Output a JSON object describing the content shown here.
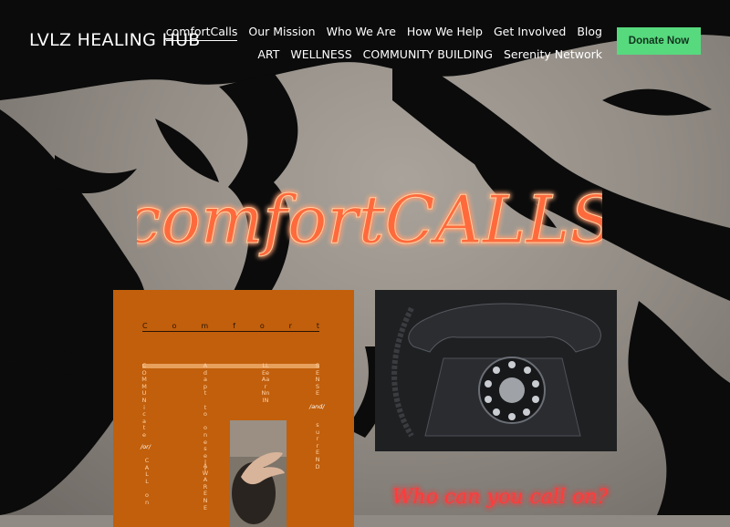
{
  "site": {
    "title": "LVLZ HEALING HUB"
  },
  "nav": {
    "row1": [
      "comfortCalls",
      "Our Mission",
      "Who We Are",
      "How We Help",
      "Get Involved",
      "Blog"
    ],
    "row2": [
      "ART",
      "WELLNESS",
      "COMMUNITY BUILDING",
      "Serenity Network"
    ],
    "active": "comfortCalls"
  },
  "donate_label": "Donate Now",
  "hero": {
    "title": "comfortCALLS"
  },
  "card": {
    "word_letters": [
      "C",
      "o",
      "m",
      "f",
      "o",
      "r",
      "t"
    ],
    "col1": [
      "C",
      "O",
      "M",
      "M",
      "U",
      "N",
      "i",
      "c",
      "a",
      "t",
      "e"
    ],
    "col2": [
      "A",
      "d",
      "a",
      "p",
      "t",
      "",
      "t",
      "o",
      "",
      "o",
      "n",
      "e",
      "s",
      "e",
      "l",
      "f"
    ],
    "col3": [
      "LL",
      "Ee",
      "Aa",
      "r",
      "Nn",
      "IN"
    ],
    "col4": [
      "S",
      "E",
      "N",
      "S",
      "E"
    ],
    "col1b": [
      "C",
      "A",
      "L",
      "L",
      "",
      "o",
      "n"
    ],
    "col2b": [
      "A",
      "W",
      "A",
      "R",
      "E",
      "N",
      "E"
    ],
    "col4b": [
      "s",
      "u",
      "r",
      "r",
      "E",
      "N",
      "D"
    ],
    "tag_or": "/or/",
    "tag_and": "/and/"
  },
  "tagline": "Who can you call on?",
  "colors": {
    "accent": "#57d97e",
    "card": "#c15f0c",
    "neon": "#ff5a3c"
  }
}
